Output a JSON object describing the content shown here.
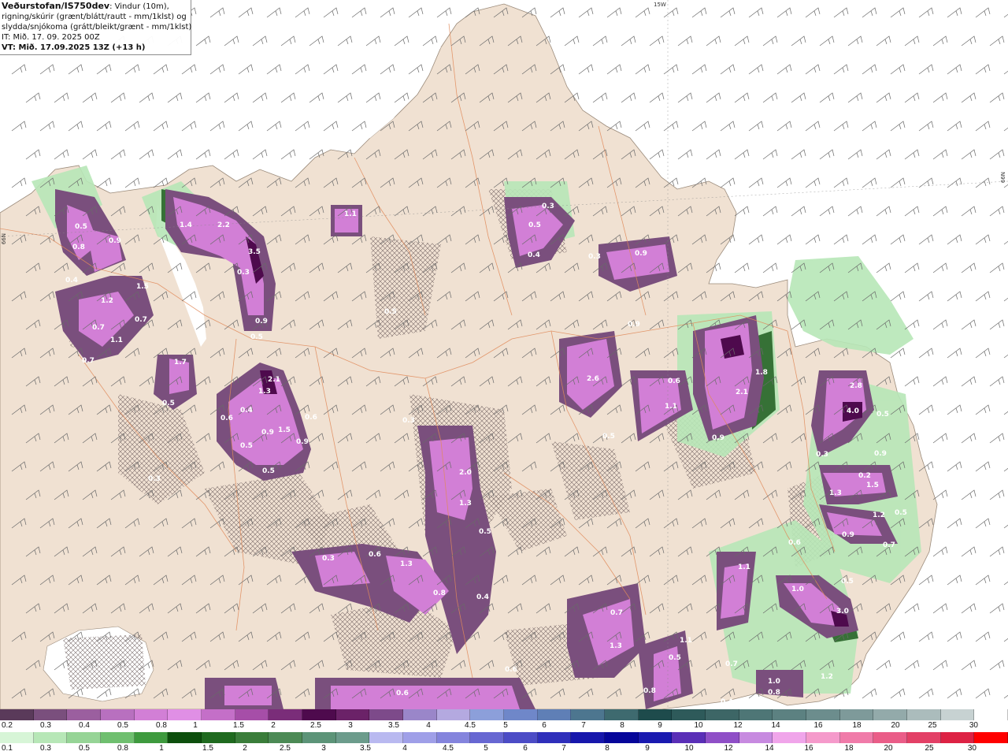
{
  "info": {
    "title": "Veðurstofan/IS750dev",
    "line1": ": Vindur (10m),",
    "line2": "rigning/skúrir (grænt/blátt/rautt - mm/1klst) og",
    "line3": "slydda/snjókoma (grátt/bleikt/grænt - mm/1klst)",
    "it": "IT: Mið. 17. 09. 2025 00Z",
    "vt": "VT: Mið. 17.09.2025 13Z (+13 h)"
  },
  "coords": {
    "top": "15W",
    "left": "66N",
    "right": "66N"
  },
  "map_labels": [
    {
      "t": "0.5"
    },
    {
      "t": "0.8"
    },
    {
      "t": "0.9"
    },
    {
      "t": "0.4"
    },
    {
      "t": "1.2"
    },
    {
      "t": "1.5"
    },
    {
      "t": "0.7"
    },
    {
      "t": "0.7"
    },
    {
      "t": "1.1"
    },
    {
      "t": "0.7"
    },
    {
      "t": "1.7"
    },
    {
      "t": "0.5"
    },
    {
      "t": "1.4"
    },
    {
      "t": "2.2"
    },
    {
      "t": "3.5"
    },
    {
      "t": "0.9"
    },
    {
      "t": "0.5"
    },
    {
      "t": "0.3"
    },
    {
      "t": "1.1"
    },
    {
      "t": "2.1"
    },
    {
      "t": "1.3"
    },
    {
      "t": "0.6"
    },
    {
      "t": "0.4"
    },
    {
      "t": "0.5"
    },
    {
      "t": "0.9"
    },
    {
      "t": "1.5"
    },
    {
      "t": "0.5"
    },
    {
      "t": "0.9"
    },
    {
      "t": "0.6"
    },
    {
      "t": "0.3"
    },
    {
      "t": "0.5"
    },
    {
      "t": "0.3"
    },
    {
      "t": "0.4"
    },
    {
      "t": "0.5"
    },
    {
      "t": "0.3"
    },
    {
      "t": "0.3"
    },
    {
      "t": "0.9"
    },
    {
      "t": "0.9"
    },
    {
      "t": "0.5"
    },
    {
      "t": "0.6"
    },
    {
      "t": "1.1"
    },
    {
      "t": "2.6"
    },
    {
      "t": "2.1"
    },
    {
      "t": "1.8"
    },
    {
      "t": "0.9"
    },
    {
      "t": "2.0"
    },
    {
      "t": "1.3"
    },
    {
      "t": "0.5"
    },
    {
      "t": "0.3"
    },
    {
      "t": "0.6"
    },
    {
      "t": "1.3"
    },
    {
      "t": "0.8"
    },
    {
      "t": "0.4"
    },
    {
      "t": "0.7"
    },
    {
      "t": "1.3"
    },
    {
      "t": "0.5"
    },
    {
      "t": "1.1"
    },
    {
      "t": "0.7"
    },
    {
      "t": "0.8"
    },
    {
      "t": "0.6"
    },
    {
      "t": "0.6"
    },
    {
      "t": "2.8"
    },
    {
      "t": "4.0"
    },
    {
      "t": "0.5"
    },
    {
      "t": "0.9"
    },
    {
      "t": "1.3"
    },
    {
      "t": "1.5"
    },
    {
      "t": "1.2"
    },
    {
      "t": "0.9"
    },
    {
      "t": "0.7"
    },
    {
      "t": "0.6"
    },
    {
      "t": "1.0"
    },
    {
      "t": "0.5"
    },
    {
      "t": "3.0"
    },
    {
      "t": "1.1"
    },
    {
      "t": "1.2"
    },
    {
      "t": "1.0"
    },
    {
      "t": "0.8"
    },
    {
      "t": "0.4"
    },
    {
      "t": "0.3"
    },
    {
      "t": "0.5"
    },
    {
      "t": "0.2"
    }
  ],
  "legend_top": {
    "colors": [
      "#5a3a5a",
      "#7a4f7d",
      "#9b5f9f",
      "#b870bf",
      "#d27fd6",
      "#e08fe5",
      "#c46fc8",
      "#a64ea8",
      "#7a2d79",
      "#4e0a4d",
      "#6b2268",
      "#7d4a8a",
      "#9a86c9",
      "#b4a9e0",
      "#8c9fda",
      "#6f87c9",
      "#5f7fb6",
      "#4d768f",
      "#3e6a6f",
      "#1e4b4c",
      "#2e5a5a",
      "#3d6666",
      "#4e7676",
      "#5c8181",
      "#6c8d8d",
      "#7e9a9a",
      "#93aaaa",
      "#abbcbc",
      "#c7d2d2",
      "#ffffff"
    ],
    "ticks": [
      "0.2",
      "0.3",
      "0.4",
      "0.5",
      "0.8",
      "1",
      "1.5",
      "2",
      "2.5",
      "3",
      "3.5",
      "4",
      "4.5",
      "5",
      "6",
      "7",
      "8",
      "9",
      "10",
      "12",
      "14",
      "16",
      "18",
      "20",
      "25",
      "30"
    ]
  },
  "legend_bottom": {
    "colors": [
      "#d7f5d7",
      "#b7e7b7",
      "#96d496",
      "#6fbf6f",
      "#3e9a3e",
      "#0d4f0d",
      "#1f6a1f",
      "#3a7d3a",
      "#4c8a55",
      "#5c9478",
      "#6c9c8c",
      "#b9b9f0",
      "#9f9fe8",
      "#8484dd",
      "#6767d2",
      "#4c4cc6",
      "#2f2fbb",
      "#1717ac",
      "#06069a",
      "#1a1ab0",
      "#5a2fb7",
      "#8f4fc7",
      "#c78ae0",
      "#f0a5ea",
      "#f59acb",
      "#f07ba9",
      "#ea5d88",
      "#e34066",
      "#dd2244",
      "#ff0000"
    ],
    "ticks": [
      "0.1",
      "0.3",
      "0.5",
      "0.8",
      "1",
      "1.5",
      "2",
      "2.5",
      "3",
      "3.5",
      "4",
      "4.5",
      "5",
      "6",
      "7",
      "8",
      "9",
      "10",
      "12",
      "14",
      "16",
      "18",
      "20",
      "25",
      "30"
    ]
  }
}
